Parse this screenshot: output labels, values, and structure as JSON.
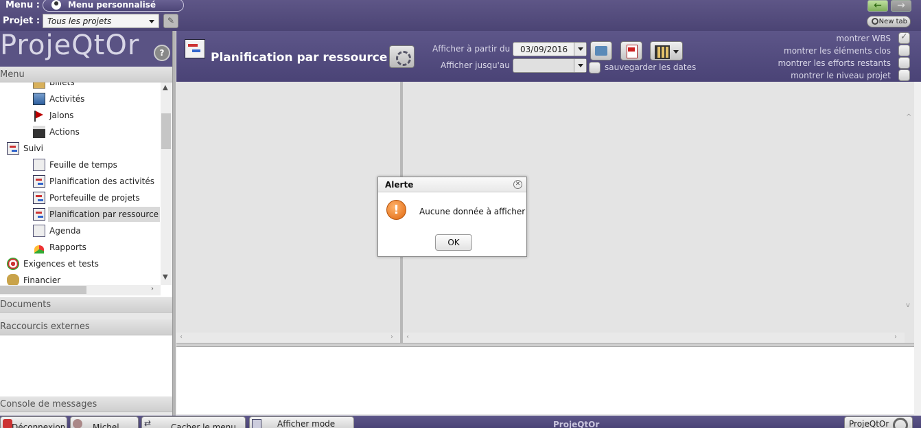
{
  "topbar": {
    "menu_label": "Menu :",
    "menu_value": "Menu personnalisé",
    "project_label": "Projet :",
    "project_value": "Tous les projets",
    "newtab_label": "New tab"
  },
  "logo": {
    "text": "ProjeQtOr",
    "help": "?"
  },
  "left": {
    "menu_header": "Menu",
    "tree": [
      {
        "label": "Billets",
        "icon": "ticket-icon"
      },
      {
        "label": "Activités",
        "icon": "activity-icon"
      },
      {
        "label": "Jalons",
        "icon": "milestone-flag-icon"
      },
      {
        "label": "Actions",
        "icon": "clapperboard-icon"
      },
      {
        "label": "Suivi",
        "icon": "gantt-icon"
      },
      {
        "label": "Feuille de temps",
        "icon": "timesheet-icon"
      },
      {
        "label": "Planification des activités",
        "icon": "gantt-icon"
      },
      {
        "label": "Portefeuille de projets",
        "icon": "portfolio-icon"
      },
      {
        "label": "Planification par ressource",
        "icon": "gantt-icon"
      },
      {
        "label": "Agenda",
        "icon": "calendar-icon"
      },
      {
        "label": "Rapports",
        "icon": "pie-chart-icon"
      },
      {
        "label": "Exigences et tests",
        "icon": "target-icon"
      },
      {
        "label": "Financier",
        "icon": "money-bag-icon"
      }
    ],
    "documents_header": "Documents",
    "shortcuts_header": "Raccourcis externes",
    "console_header": "Console de messages"
  },
  "plan": {
    "title": "Planification par ressource",
    "from_label": "Afficher à partir du",
    "from_value": "03/09/2016",
    "to_label": "Afficher jusqu'au",
    "to_value": "",
    "save_dates_label": "sauvegarder les dates",
    "options": [
      {
        "label": "montrer WBS",
        "checked": true
      },
      {
        "label": "montrer les éléments clos",
        "checked": false
      },
      {
        "label": "montrer les efforts restants",
        "checked": false
      },
      {
        "label": "montrer le niveau projet",
        "checked": false
      }
    ]
  },
  "dialog": {
    "title": "Alerte",
    "message": "Aucune donnée à afficher",
    "ok_label": "OK"
  },
  "footer": {
    "logout": "Déconnexion",
    "user": "Michel",
    "hide_menu": "Cacher le menu",
    "display_mode": "Afficher mode",
    "app_name": "ProjeQtOr",
    "right_label": "ProjeQtOr"
  }
}
